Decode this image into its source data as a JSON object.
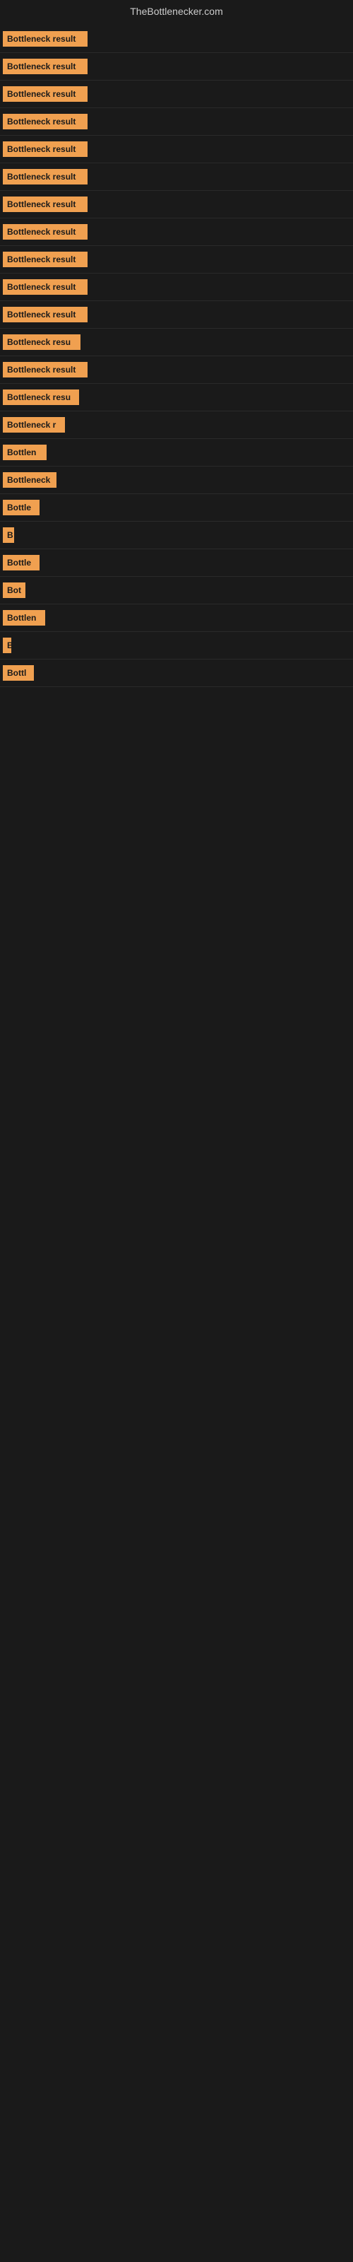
{
  "site": {
    "title": "TheBottlenecker.com"
  },
  "items": [
    {
      "label": "Bottleneck result",
      "badge_width": 120
    },
    {
      "label": "Bottleneck result",
      "badge_width": 120
    },
    {
      "label": "Bottleneck result",
      "badge_width": 120
    },
    {
      "label": "Bottleneck result",
      "badge_width": 120
    },
    {
      "label": "Bottleneck result",
      "badge_width": 120
    },
    {
      "label": "Bottleneck result",
      "badge_width": 120
    },
    {
      "label": "Bottleneck result",
      "badge_width": 120
    },
    {
      "label": "Bottleneck result",
      "badge_width": 120
    },
    {
      "label": "Bottleneck result",
      "badge_width": 120
    },
    {
      "label": "Bottleneck result",
      "badge_width": 120
    },
    {
      "label": "Bottleneck result",
      "badge_width": 120
    },
    {
      "label": "Bottleneck resu",
      "badge_width": 110
    },
    {
      "label": "Bottleneck result",
      "badge_width": 120
    },
    {
      "label": "Bottleneck resu",
      "badge_width": 108
    },
    {
      "label": "Bottleneck r",
      "badge_width": 88
    },
    {
      "label": "Bottlen",
      "badge_width": 62
    },
    {
      "label": "Bottleneck",
      "badge_width": 76
    },
    {
      "label": "Bottle",
      "badge_width": 52
    },
    {
      "label": "B",
      "badge_width": 16
    },
    {
      "label": "Bottle",
      "badge_width": 52
    },
    {
      "label": "Bot",
      "badge_width": 32
    },
    {
      "label": "Bottlen",
      "badge_width": 60
    },
    {
      "label": "B",
      "badge_width": 12
    },
    {
      "label": "Bottl",
      "badge_width": 44
    }
  ]
}
